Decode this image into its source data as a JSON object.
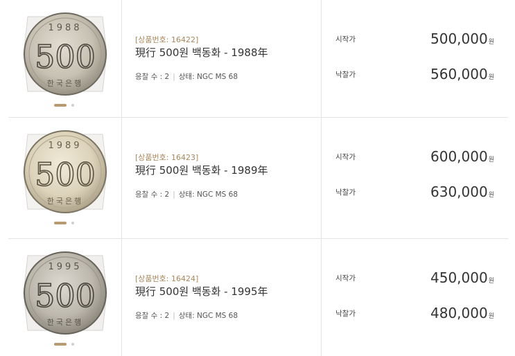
{
  "colors": {
    "accent": "#a8875a",
    "divider": "#e3e3e3",
    "dot_active": "#b79a72",
    "dot_inactive": "#cfcfcf"
  },
  "lots": [
    {
      "lot_number": "[상품번호: 16422]",
      "title": "現行 500원 백동화 - 1988年",
      "coin_year": "1988",
      "coin_denomination": "500",
      "coin_bottom_text": "한국은행",
      "bids_label": "응찰 수 : 2",
      "condition": "상태: NGC MS 68",
      "start_label": "시작가",
      "start_price": "500,000",
      "final_label": "낙찰가",
      "final_price": "560,000",
      "currency": "원"
    },
    {
      "lot_number": "[상품번호: 16423]",
      "title": "現行 500원 백동화 - 1989年",
      "coin_year": "1989",
      "coin_denomination": "500",
      "coin_bottom_text": "한국은행",
      "bids_label": "응찰 수 : 2",
      "condition": "상태: NGC MS 68",
      "start_label": "시작가",
      "start_price": "600,000",
      "final_label": "낙찰가",
      "final_price": "630,000",
      "currency": "원"
    },
    {
      "lot_number": "[상품번호: 16424]",
      "title": "現行 500원 백동화 - 1995年",
      "coin_year": "1995",
      "coin_denomination": "500",
      "coin_bottom_text": "한국은행",
      "bids_label": "응찰 수 : 2",
      "condition": "상태: NGC MS 68",
      "start_label": "시작가",
      "start_price": "450,000",
      "final_label": "낙찰가",
      "final_price": "480,000",
      "currency": "원"
    }
  ]
}
